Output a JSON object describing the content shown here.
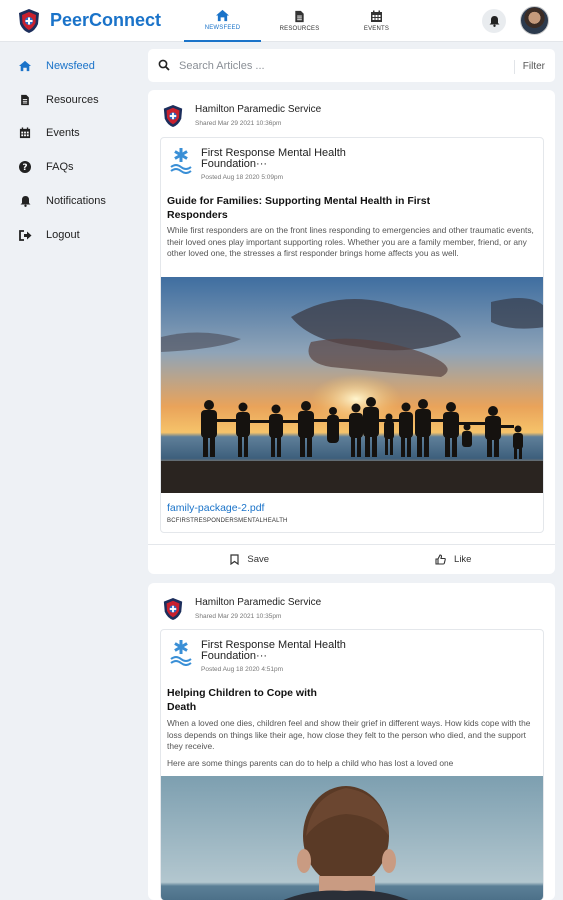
{
  "app": {
    "brand": "PeerConnect",
    "accent": "#1a73c9"
  },
  "topnav": {
    "tabs": [
      {
        "label": "NEWSFEED",
        "icon": "home-icon",
        "active": true
      },
      {
        "label": "RESOURCES",
        "icon": "document-icon",
        "active": false
      },
      {
        "label": "EVENTS",
        "icon": "calendar-icon",
        "active": false
      }
    ]
  },
  "sidebar": {
    "items": [
      {
        "label": "Newsfeed",
        "icon": "home-icon",
        "active": true
      },
      {
        "label": "Resources",
        "icon": "document-icon",
        "active": false
      },
      {
        "label": "Events",
        "icon": "calendar-icon",
        "active": false
      },
      {
        "label": "FAQs",
        "icon": "question-icon",
        "active": false
      },
      {
        "label": "Notifications",
        "icon": "bell-icon",
        "active": false
      },
      {
        "label": "Logout",
        "icon": "logout-icon",
        "active": false
      }
    ]
  },
  "search": {
    "placeholder": "Search Articles ...",
    "filter_label": "Filter"
  },
  "posts": [
    {
      "org": "Hamilton Paramedic Service",
      "shared": "Shared Mar 29 2021 10:36pm",
      "source": "First Response Mental Health Foundation···",
      "posted": "Posted Aug 18 2020 5:09pm",
      "title": "Guide for Families: Supporting Mental Health in First Responders",
      "body": "While first responders are on the front lines responding to emergencies and other traumatic events, their loved ones play important supporting roles. Whether you are a family member, friend, or any other loved one, the stresses a first responder brings home affects you as well.",
      "attachment": "family-package-2.pdf",
      "tag": "BCFIRSTRESPONDERSMENTALHEALTH",
      "save_label": "Save",
      "like_label": "Like"
    },
    {
      "org": "Hamilton Paramedic Service",
      "shared": "Shared Mar 29 2021 10:35pm",
      "source": "First Response Mental Health Foundation···",
      "posted": "Posted Aug 18 2020 4:51pm",
      "title": "Helping Children to Cope with Death",
      "body": "When a loved one dies, children feel and show their grief in different ways. How kids cope with the loss depends on things like their age, how close they felt to the person who died, and the support they receive.",
      "body2": "Here are some things parents can do to help a child who has lost a loved one"
    }
  ]
}
